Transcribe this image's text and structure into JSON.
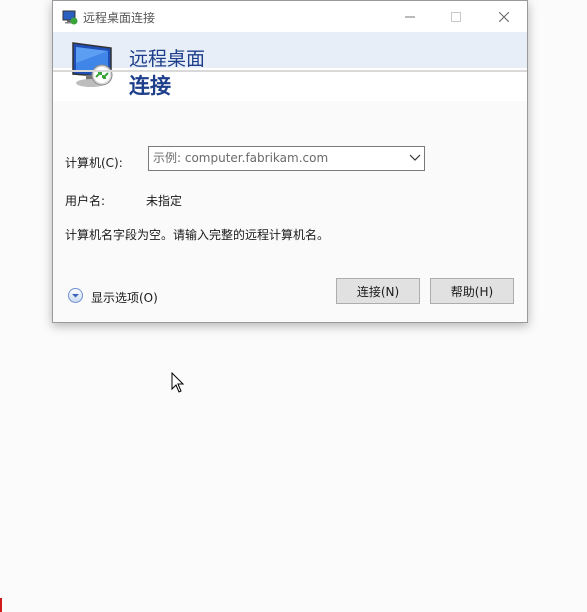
{
  "window": {
    "title": "远程桌面连接",
    "banner_line1": "远程桌面",
    "banner_line2": "连接"
  },
  "form": {
    "computer_label": "计算机(C):",
    "computer_placeholder": "示例: computer.fabrikam.com",
    "computer_value": "",
    "username_label": "用户名:",
    "username_value": "未指定",
    "message": "计算机名字段为空。请输入完整的远程计算机名。"
  },
  "footer": {
    "options_label": "显示选项(O)",
    "connect_label": "连接(N)",
    "help_label": "帮助(H)"
  },
  "colors": {
    "accent": "#1d3e8a",
    "banner_band": "#e8eef7",
    "options_icon": "#3a62b8",
    "icon_arrow": "#3aa43a"
  },
  "icons": [
    "rdp-app-icon",
    "minimize-icon",
    "maximize-icon",
    "close-icon",
    "rdp-monitor-icon",
    "chevron-down-icon",
    "expand-options-icon",
    "mouse-cursor-icon"
  ]
}
